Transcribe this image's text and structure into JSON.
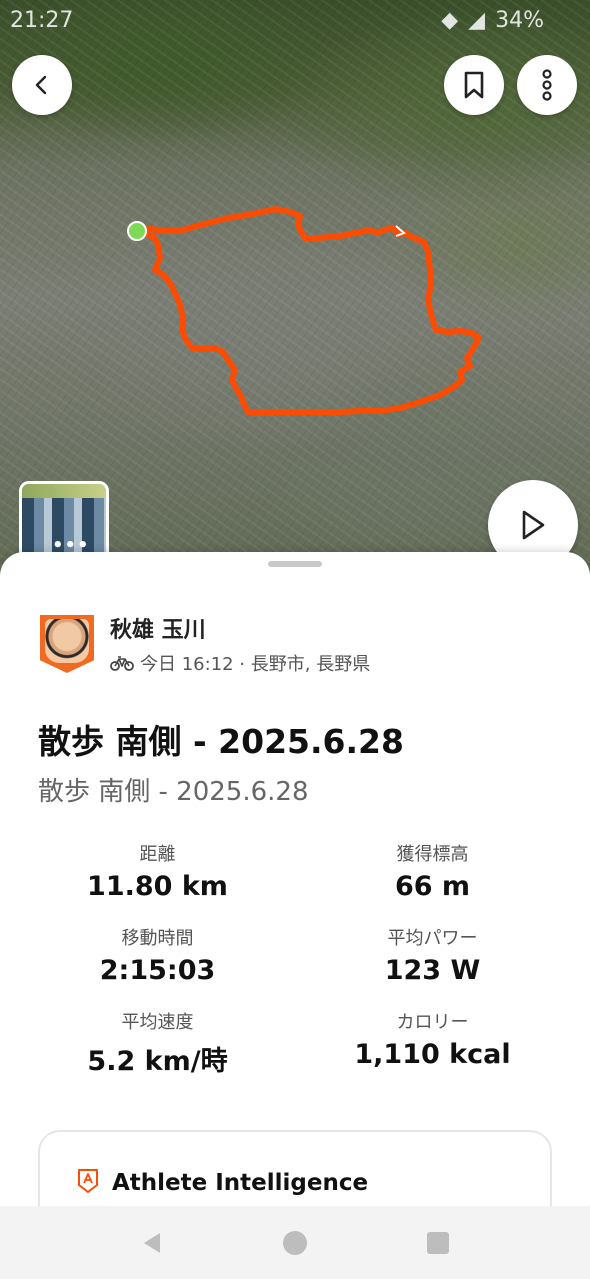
{
  "status_bar": {
    "time": "21:27",
    "battery": "34%"
  },
  "map": {
    "route_color": "#fc4c02",
    "start_marker_color": "#7ed957",
    "photo_count_label": "•••"
  },
  "activity": {
    "athlete_name": "秋雄 玉川",
    "meta": "今日 16:12 · 長野市, 長野県",
    "sport_icon": "bike-icon",
    "title": "散歩 南側 - 2025.6.28",
    "description": "散歩 南側 - 2025.6.28"
  },
  "stats": [
    {
      "label": "距離",
      "value": "11.80 km"
    },
    {
      "label": "獲得標高",
      "value": "66 m"
    },
    {
      "label": "移動時間",
      "value": "2:15:03"
    },
    {
      "label": "平均パワー",
      "value": "123 W"
    },
    {
      "label": "平均速度",
      "value": "5.2 km/時"
    },
    {
      "label": "カロリー",
      "value": "1,110 kcal"
    }
  ],
  "ai_card": {
    "title": "Athlete Intelligence"
  },
  "colors": {
    "accent": "#fc4c02"
  }
}
